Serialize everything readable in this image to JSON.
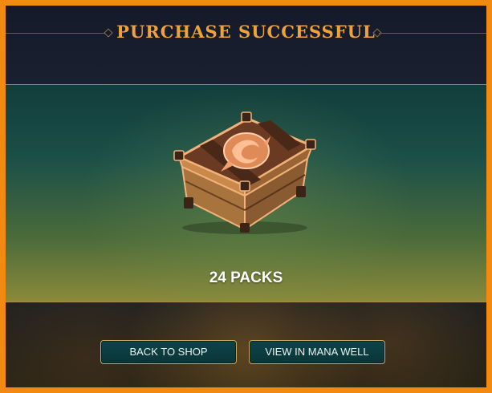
{
  "header": {
    "title": "PURCHASE SUCCESSFUL"
  },
  "showcase": {
    "item_icon": "chest-icon",
    "pack_count_label": "24 PACKS"
  },
  "actions": {
    "back_to_shop_label": "BACK TO SHOP",
    "view_mana_well_label": "VIEW IN MANA WELL"
  },
  "colors": {
    "accent": "#f0a23a",
    "frame": "#f28a12",
    "button_border": "#c9a85a",
    "button_fill": "#0d4448"
  }
}
